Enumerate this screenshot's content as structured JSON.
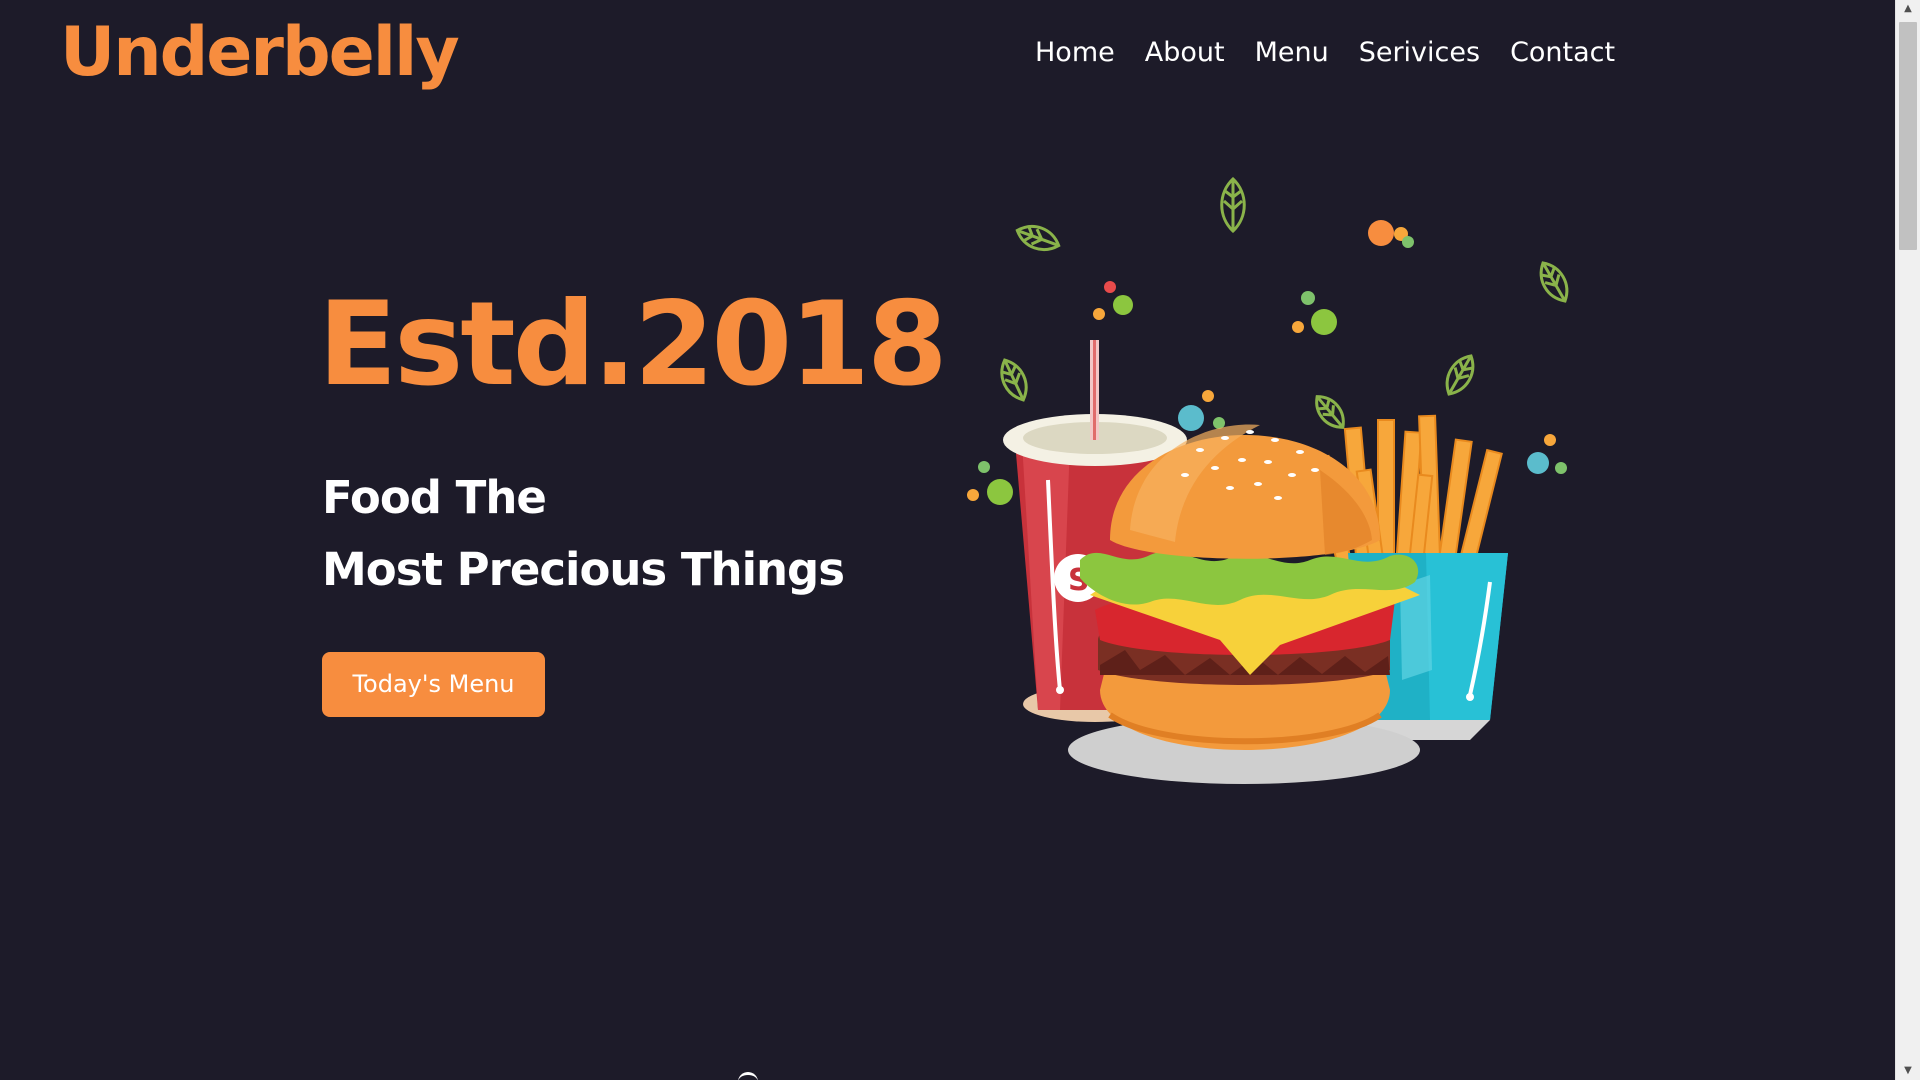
{
  "header": {
    "logo": "Underbelly",
    "nav": [
      "Home",
      "About",
      "Menu",
      "Serivices",
      "Contact"
    ]
  },
  "hero": {
    "year": "Estd.2018",
    "tagline_line1": "Food The",
    "tagline_line2": "Most Precious Things",
    "cta_label": "Today's Menu"
  },
  "colors": {
    "background": "#1d1b29",
    "accent": "#f78d3f",
    "text": "#ffffff"
  },
  "illustration": {
    "icon": "burger-fries-soda-illustration"
  }
}
